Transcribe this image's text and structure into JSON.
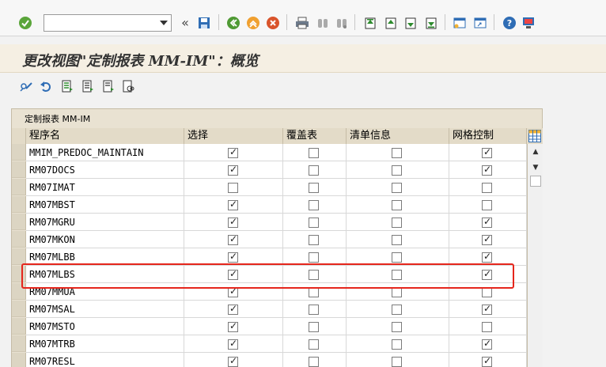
{
  "toolbar": {
    "command_field_value": "",
    "command_field_placeholder": "",
    "icons": [
      "enter-icon",
      "back-double-icon",
      "save-icon",
      "back-icon",
      "exit-icon",
      "cancel-icon",
      "print-icon",
      "find-icon",
      "find-next-icon",
      "first-page-icon",
      "previous-page-icon",
      "next-page-icon",
      "last-page-icon",
      "create-session-icon",
      "shortcut-icon",
      "help-icon",
      "customize-layout-icon"
    ]
  },
  "title": "更改视图\"定制报表 MM-IM\"：概览",
  "app_toolbar": {
    "icons": [
      "display-change-icon",
      "undo-icon",
      "select-all-icon",
      "deselect-all-icon",
      "select-block-icon",
      "other-view-icon"
    ]
  },
  "table": {
    "caption": "定制报表 MM-IM",
    "columns": [
      "程序名",
      "选择",
      "覆盖表",
      "清单信息",
      "网格控制"
    ],
    "rows": [
      {
        "program": "MMIM_PREDOC_MAINTAIN",
        "select": true,
        "override": false,
        "list_info": false,
        "grid": true
      },
      {
        "program": "RM07DOCS",
        "select": true,
        "override": false,
        "list_info": false,
        "grid": true
      },
      {
        "program": "RM07IMAT",
        "select": false,
        "override": false,
        "list_info": false,
        "grid": false
      },
      {
        "program": "RM07MBST",
        "select": true,
        "override": false,
        "list_info": false,
        "grid": false
      },
      {
        "program": "RM07MGRU",
        "select": true,
        "override": false,
        "list_info": false,
        "grid": true
      },
      {
        "program": "RM07MKON",
        "select": true,
        "override": false,
        "list_info": false,
        "grid": true
      },
      {
        "program": "RM07MLBB",
        "select": true,
        "override": false,
        "list_info": false,
        "grid": true
      },
      {
        "program": "RM07MLBS",
        "select": true,
        "override": false,
        "list_info": false,
        "grid": true
      },
      {
        "program": "RM07MMUA",
        "select": true,
        "override": false,
        "list_info": false,
        "grid": false
      },
      {
        "program": "RM07MSAL",
        "select": true,
        "override": false,
        "list_info": false,
        "grid": true
      },
      {
        "program": "RM07MSTO",
        "select": true,
        "override": false,
        "list_info": false,
        "grid": false
      },
      {
        "program": "RM07MTRB",
        "select": true,
        "override": false,
        "list_info": false,
        "grid": true
      },
      {
        "program": "RM07RESL",
        "select": true,
        "override": false,
        "list_info": false,
        "grid": true
      }
    ]
  },
  "colors": {
    "highlight": "#e5261c",
    "title_bg": "#f5efe3",
    "table_frame": "#e9e2d2"
  }
}
